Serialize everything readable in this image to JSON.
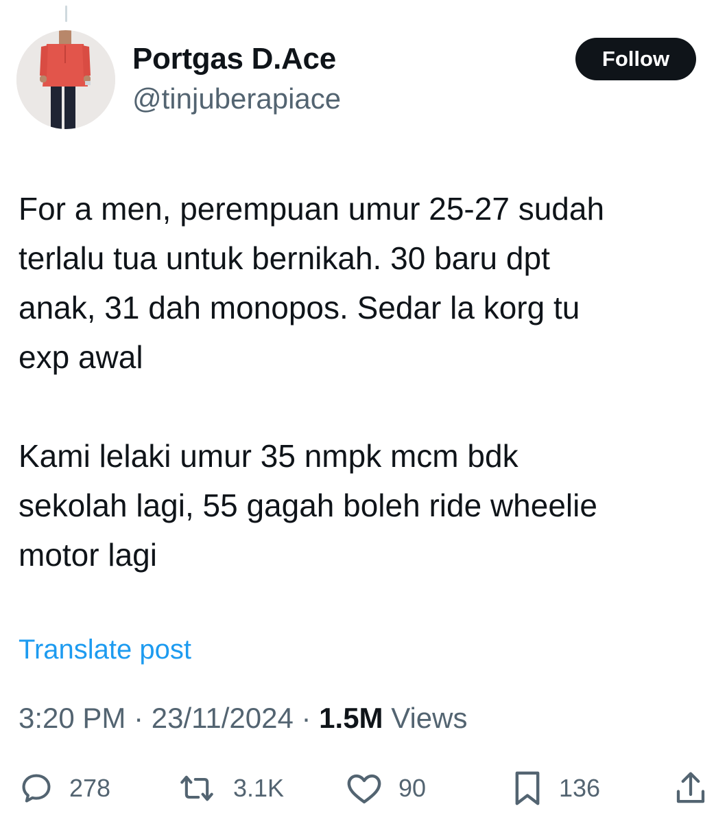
{
  "author": {
    "display_name": "Portgas D.Ace",
    "handle": "@tinjuberapiace",
    "avatar_icon": "profile-photo"
  },
  "follow_button": {
    "label": "Follow"
  },
  "tweet": {
    "text": "For a men, perempuan umur 25-27 sudah\nterlalu tua untuk bernikah. 30 baru dpt\nanak, 31 dah monopos. Sedar la korg tu\nexp awal\n\nKami lelaki umur 35 nmpk mcm bdk\nsekolah lagi, 55 gagah boleh ride wheelie\nmotor lagi"
  },
  "translate": {
    "label": "Translate post"
  },
  "meta": {
    "time": "3:20 PM",
    "separator": " · ",
    "date": "23/11/2024",
    "views_count": "1.5M",
    "views_label": " Views"
  },
  "actions": {
    "replies": {
      "icon": "reply-icon",
      "count": "278"
    },
    "reposts": {
      "icon": "repost-icon",
      "count": "3.1K"
    },
    "likes": {
      "icon": "like-icon",
      "count": "90"
    },
    "bookmarks": {
      "icon": "bookmark-icon",
      "count": "136"
    },
    "share": {
      "icon": "share-icon"
    }
  },
  "colors": {
    "text_primary": "#0f1419",
    "text_secondary": "#536471",
    "link": "#1d9bf0",
    "follow_bg": "#0f1419"
  }
}
